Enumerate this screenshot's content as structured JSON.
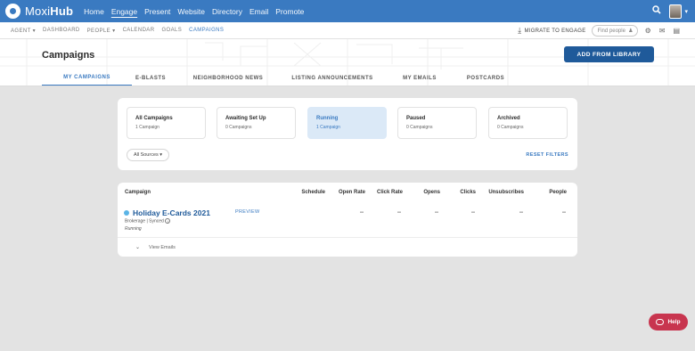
{
  "brand": {
    "name_light": "Moxi",
    "name_bold": "Hub"
  },
  "topnav": [
    "Home",
    "Engage",
    "Present",
    "Website",
    "Directory",
    "Email",
    "Promote"
  ],
  "topnav_active": "Engage",
  "subnav": [
    "AGENT",
    "DASHBOARD",
    "PEOPLE",
    "CALENDAR",
    "GOALS",
    "CAMPAIGNS"
  ],
  "subnav_active": "CAMPAIGNS",
  "migrate_label": "MIGRATE TO ENGAGE",
  "find_placeholder": "Find people",
  "page_title": "Campaigns",
  "add_button": "ADD FROM LIBRARY",
  "tabs": [
    "MY CAMPAIGNS",
    "E-BLASTS",
    "NEIGHBORHOOD NEWS",
    "LISTING ANNOUNCEMENTS",
    "MY EMAILS",
    "POSTCARDS"
  ],
  "status_cards": [
    {
      "title": "All Campaigns",
      "count": "1 Campaign"
    },
    {
      "title": "Awaiting Set Up",
      "count": "0 Campaigns"
    },
    {
      "title": "Running",
      "count": "1 Campaign"
    },
    {
      "title": "Paused",
      "count": "0 Campaigns"
    },
    {
      "title": "Archived",
      "count": "0 Campaigns"
    }
  ],
  "selected_status": "Running",
  "sources_label": "All Sources",
  "reset_label": "RESET FILTERS",
  "table": {
    "headers": [
      "Campaign",
      "Schedule",
      "Open Rate",
      "Click Rate",
      "Opens",
      "Clicks",
      "Unsubscribes",
      "People"
    ],
    "row": {
      "name": "Holiday E-Cards 2021",
      "sub": "Brokerage | Synced",
      "status": "Running",
      "preview": "PREVIEW",
      "values": [
        "--",
        "--",
        "--",
        "--",
        "--",
        "--"
      ]
    },
    "view_emails": "View Emails"
  },
  "help_label": "Help",
  "colors": {
    "primary": "#3a7ac1",
    "dark_button": "#1f5a9a",
    "help": "#c8354f",
    "selected_card": "#dbe9f7"
  }
}
